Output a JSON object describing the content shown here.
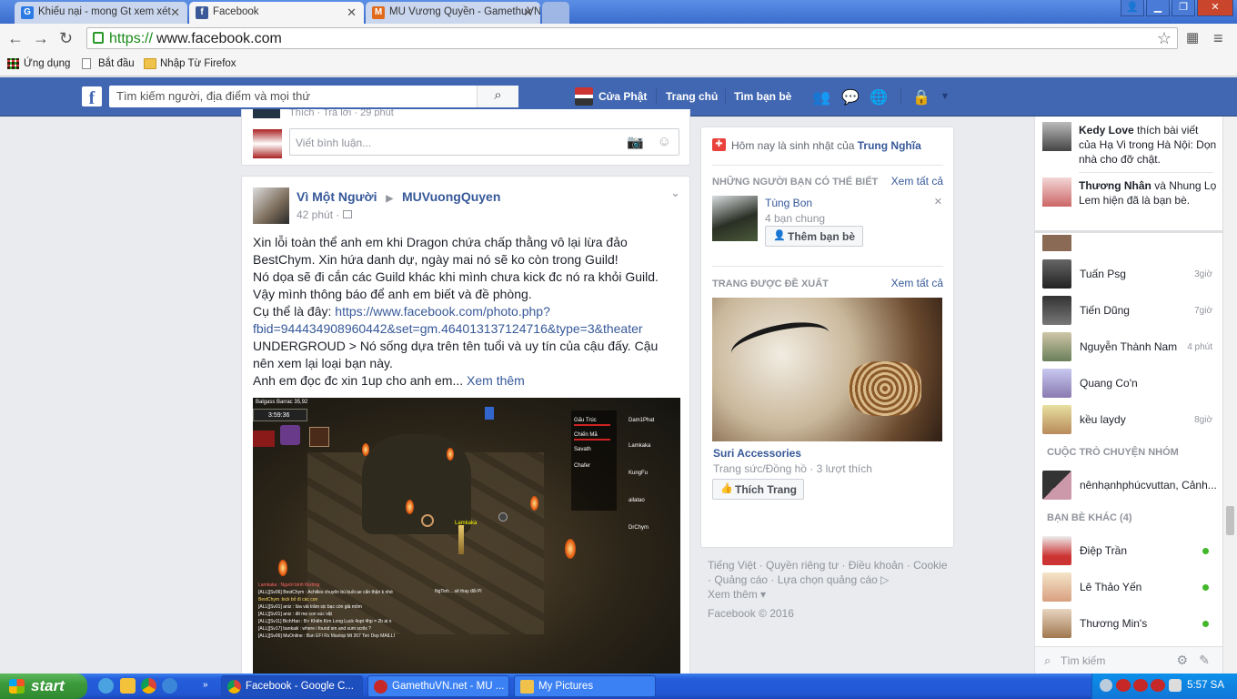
{
  "browser": {
    "tabs": [
      {
        "title": "Khiếu nại - mong Gt xem xét",
        "icon": "G",
        "color": "#2c7be5"
      },
      {
        "title": "Facebook",
        "icon": "f",
        "color": "#3b5998"
      },
      {
        "title": "MU Vương Quyền - GamethuVN",
        "icon": "M",
        "color": "#e06a1a"
      }
    ],
    "url_scheme": "https://",
    "url_rest": "www.facebook.com",
    "bookmarks": [
      "Ứng dụng",
      "Bắt đầu",
      "Nhập Từ Firefox"
    ]
  },
  "fb_header": {
    "search_placeholder": "Tìm kiếm người, địa điểm và mọi thứ",
    "profile_name": "Cửa Phật",
    "home": "Trang chủ",
    "find_friends": "Tìm bạn bè"
  },
  "comment_box": {
    "placeholder": "Viết bình luận...",
    "cut_text": "Thích · Trả lời · 29 phút"
  },
  "post": {
    "author": "Vì Một Người",
    "arrow": "▶",
    "group": "MUVuongQuyen",
    "time": "42 phút",
    "lines": [
      "Xin lỗi toàn thể anh em khi Dragon chứa chấp thằng vô lại lừa đảo",
      "BestChym. Xin hứa danh dự, ngày mai nó sẽ ko còn trong Guild!",
      "Nó dọa sẽ đi cắn các Guild khác khi mình chưa kick đc nó ra khỏi Guild.",
      "Vậy mình thông báo để anh em biết và đề phòng."
    ],
    "link_prefix": "Cụ thể là đây: ",
    "link_1": "https://www.facebook.com/photo.php?",
    "link_2": "fbid=944434908960442&set=gm.464013137124716&type=3&theater",
    "lines2": [
      "UNDERGROUD > Nó sống dựa trên tên tuổi và uy tín của cậu đấy. Cậu",
      "nên xem lại loại bạn này."
    ],
    "last_line": "Anh em đọc đc xin 1up cho anh em...",
    "see_more": "Xem thêm",
    "game": {
      "hud_name": "Balgass Barrac 35,92",
      "timer": "3:59:36",
      "player": "Lamkaka",
      "party": [
        "Gấu Trúc",
        "Chiến Mã",
        "Savath",
        "Chafer"
      ],
      "party2": [
        "Dam1Phat",
        "Lamkaka",
        "KungFu",
        "ailatao",
        "DrChym"
      ],
      "chat": [
        "Lamkaka : Người bình thường",
        "[ALL][Sv06] BestChym : Achilles chuyên bú buồi ae cẩn thận k nhé",
        "BestChym :kick bố đi các con",
        "[ALL][Sv01] aniz : lừa vải trăm sịc bạc còn già mồm",
        "[ALL][Sv01] aniz : đit mẹ con súc vật",
        "[ALL][Sv11] BichHan : B> Khiên Kim Long Luck 4opt 4hp = 2b ai n",
        "[ALL][Sv17] bankaiii : where i found sm and sum scrils ?",
        "[ALL][Sv06] MuOnline : Ban EFI Rs Maxtop Mt 267 Ten Dep MAILLI"
      ],
      "notice": "NgTinh... sẽ thay đổi Pl"
    }
  },
  "right_col": {
    "birthday_prefix": "Hôm nay là sinh nhật của ",
    "birthday_name": "Trung Nghĩa",
    "pymk_title": "NHỮNG NGƯỜI BẠN CÓ THỂ BIẾT",
    "see_all": "Xem tất cả",
    "pymk_name": "Tùng Bon",
    "pymk_mutual": "4 bạn chung",
    "add_friend": "Thêm bạn bè",
    "suggested_title": "TRANG ĐƯỢC ĐỀ XUẤT",
    "page_name": "Suri Accessories",
    "page_meta": "Trang sức/Đồng hồ · 3 lượt thích",
    "like_page": "Thích Trang",
    "footer_line1": "Tiếng Việt · Quyền riêng tư · Điều khoản · Cookie",
    "footer_line2": "· Quảng cáo · Lựa chọn quảng cáo",
    "footer_more": "Xem thêm",
    "copyright": "Facebook © 2016"
  },
  "ticker": [
    {
      "name": "Kedy Love",
      "text": " thích bài viết của Hạ Vi trong Hà Nội: Dọn nhà cho đỡ chật."
    },
    {
      "name": "Thương Nhân",
      "text": " và Nhung Lọ Lem hiện đã là bạn bè."
    }
  ],
  "chat_contacts": [
    {
      "name": "Tuấn Psg",
      "time": "3giờ"
    },
    {
      "name": "Tiến Dũng",
      "time": "7giờ"
    },
    {
      "name": "Nguyễn Thành Nam",
      "time": "4 phút"
    },
    {
      "name": "Quang Co'n",
      "time": ""
    },
    {
      "name": "kều laydy",
      "time": "8giờ"
    }
  ],
  "chat_group_head": "CUỘC TRÒ CHUYỆN NHÓM",
  "chat_group": "nênhạnhphúcvuttan, Cảnh...",
  "other_friends_head": "BẠN BÈ KHÁC (4)",
  "other_friends": [
    "Điệp Trần",
    "Lê Thảo Yến",
    "Thương Min's"
  ],
  "chat_search": "Tìm kiếm",
  "taskbar": {
    "start": "start",
    "tasks": [
      "Facebook - Google C...",
      "GamethuVN.net - MU ...",
      "My Pictures"
    ],
    "clock": "5:57 SA"
  }
}
